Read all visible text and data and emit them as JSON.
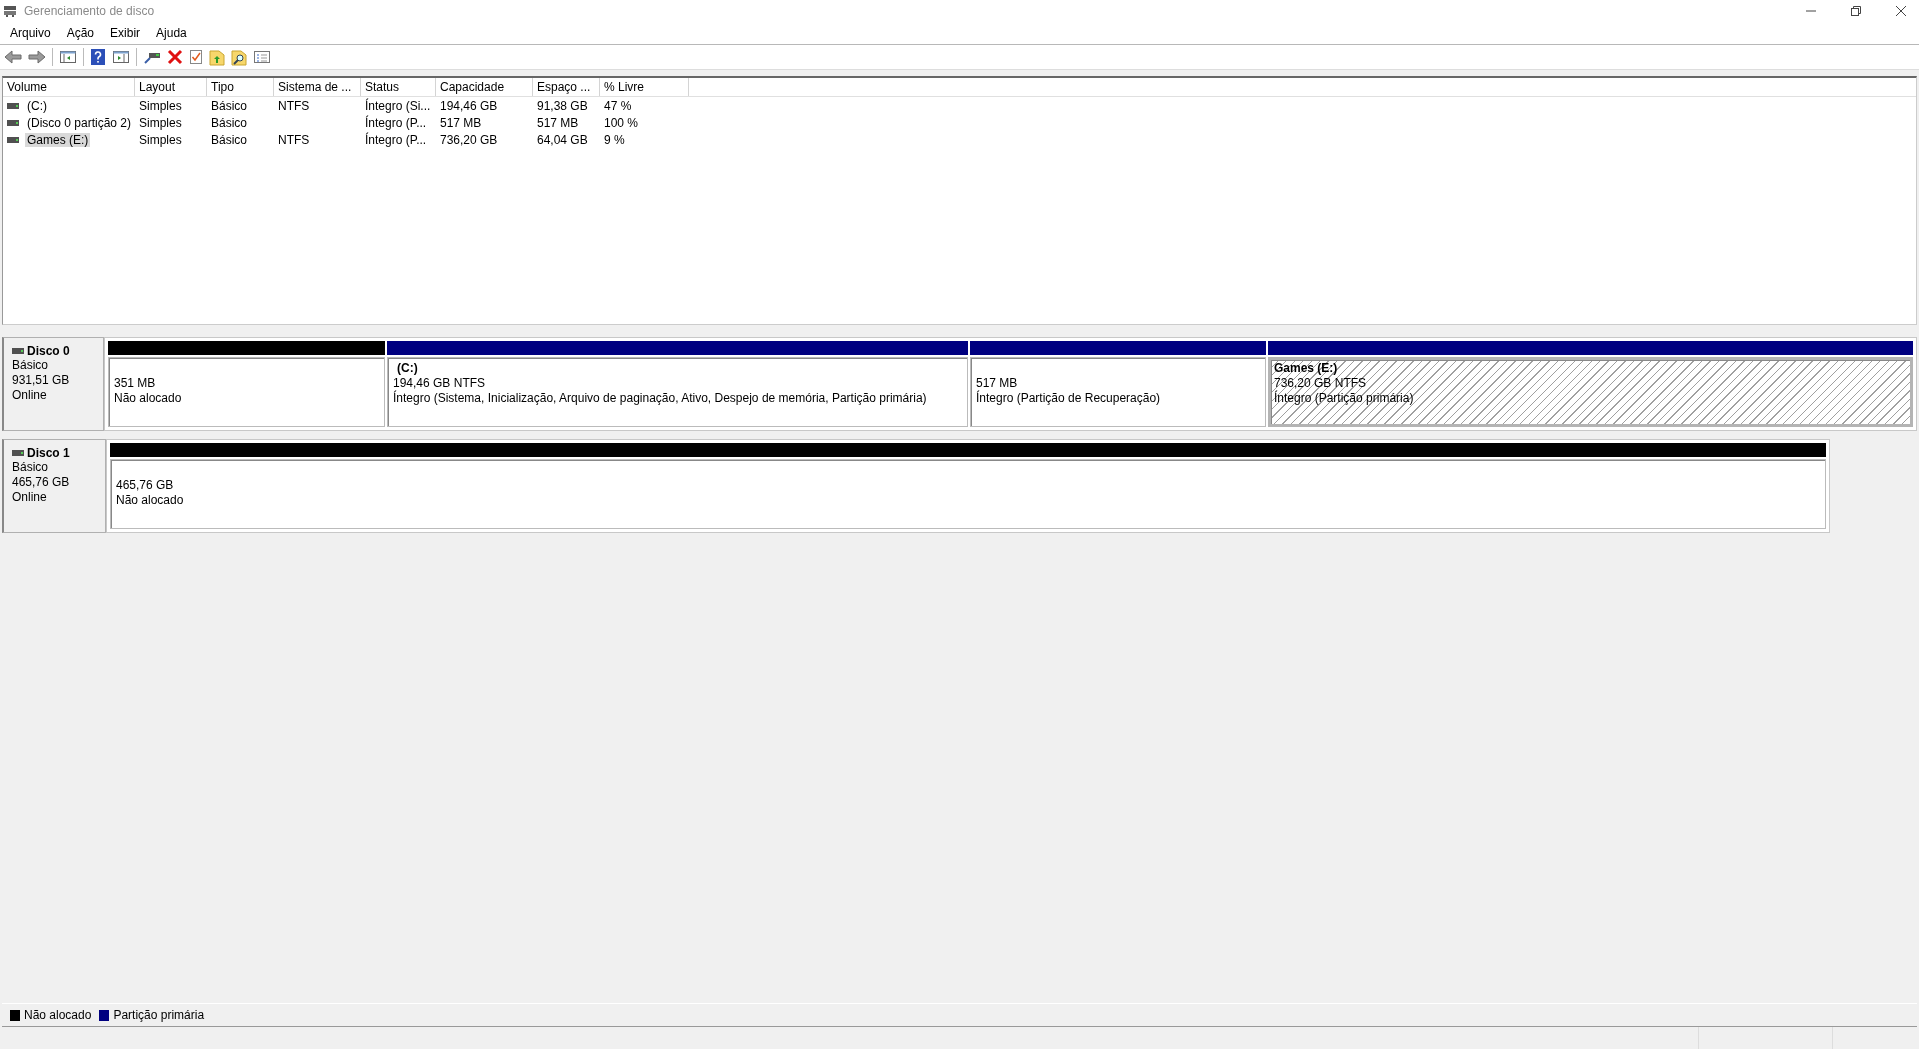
{
  "window": {
    "title": "Gerenciamento de disco"
  },
  "menu": [
    "Arquivo",
    "Ação",
    "Exibir",
    "Ajuda"
  ],
  "table": {
    "columns": [
      "Volume",
      "Layout",
      "Tipo",
      "Sistema de ...",
      "Status",
      "Capacidade",
      "Espaço ...",
      "% Livre"
    ],
    "rows": [
      {
        "selected": false,
        "cells": [
          "(C:)",
          "Simples",
          "Básico",
          "NTFS",
          "Íntegro (Si...",
          "194,46 GB",
          "91,38 GB",
          "47 %"
        ]
      },
      {
        "selected": false,
        "cells": [
          "(Disco 0 partição 2)",
          "Simples",
          "Básico",
          "",
          "Íntegro (P...",
          "517 MB",
          "517 MB",
          "100 %"
        ]
      },
      {
        "selected": true,
        "cells": [
          "Games (E:)",
          "Simples",
          "Básico",
          "NTFS",
          "Íntegro (P...",
          "736,20 GB",
          "64,04 GB",
          "9 %"
        ]
      }
    ]
  },
  "disks": [
    {
      "name": "Disco 0",
      "type": "Básico",
      "size": "931,51 GB",
      "status": "Online",
      "partitions": [
        {
          "kind": "unallocated",
          "selected": false,
          "lines": [
            "351 MB",
            "Não alocado"
          ]
        },
        {
          "kind": "primary",
          "selected": false,
          "title": "(C:)",
          "lines": [
            "194,46 GB NTFS",
            "Íntegro (Sistema, Inicialização, Arquivo de paginação, Ativo, Despejo de memória, Partição primária)"
          ]
        },
        {
          "kind": "primary",
          "selected": false,
          "lines": [
            "517 MB",
            "Íntegro (Partição de Recuperação)"
          ]
        },
        {
          "kind": "primary",
          "selected": true,
          "title": "Games  (E:)",
          "lines": [
            "736,20 GB NTFS",
            "Íntegro (Partição primária)"
          ]
        }
      ]
    },
    {
      "name": "Disco 1",
      "type": "Básico",
      "size": "465,76 GB",
      "status": "Online",
      "partitions": [
        {
          "kind": "unallocated",
          "selected": false,
          "lines": [
            "465,76 GB",
            "Não alocado"
          ]
        }
      ]
    }
  ],
  "legend": [
    {
      "label": "Não alocado",
      "color": "#000000"
    },
    {
      "label": "Partição primária",
      "color": "#000080"
    }
  ]
}
